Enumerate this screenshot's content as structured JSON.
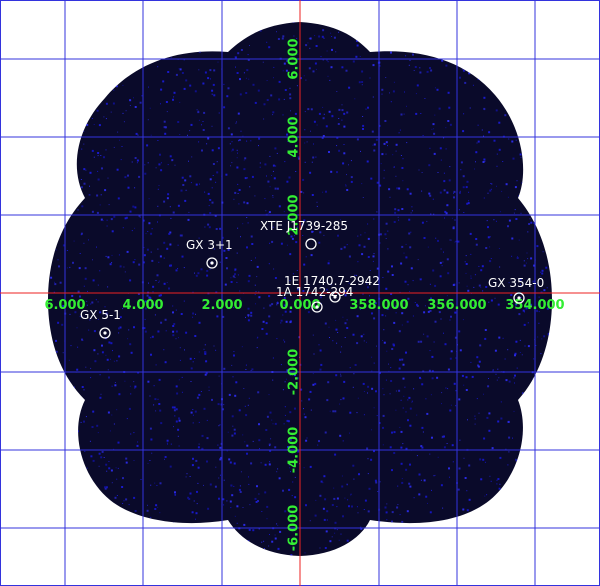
{
  "image": {
    "background_color": "#ffffff",
    "field_color": "#0a0a2a",
    "photon_color": "#1a1acc",
    "grid_color": "#3333dd",
    "axis_color": "#ee2222",
    "tick_color": "#33ee33",
    "marker_color": "#ffffff"
  },
  "axes": {
    "longitude_ticks": [
      "6.000",
      "4.000",
      "2.000",
      "0.000",
      "358.000",
      "356.000",
      "354.000"
    ],
    "latitude_ticks": [
      "6.000",
      "4.000",
      "2.000",
      "-2.000",
      "-4.000",
      "-6.000"
    ]
  },
  "sources": [
    {
      "name": "GX 3+1",
      "marker": "circle-dot"
    },
    {
      "name": "XTE J1739-285",
      "marker": "circle"
    },
    {
      "name": "1E 1740.7-2942",
      "marker": "circle-dot"
    },
    {
      "name": "1A 1742-294",
      "marker": "circle-dot"
    },
    {
      "name": "GX 354-0",
      "marker": "circle-dot"
    },
    {
      "name": "GX 5-1",
      "marker": "circle-dot"
    }
  ]
}
